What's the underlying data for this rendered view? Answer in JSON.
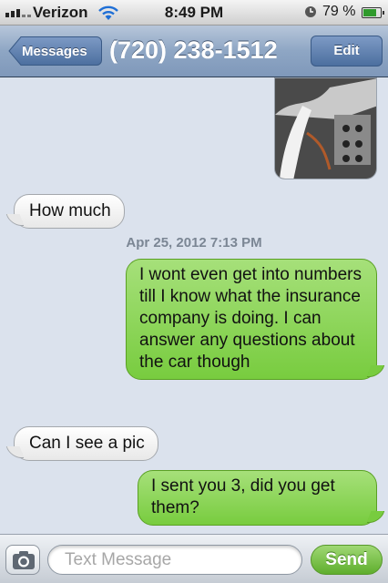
{
  "status_bar": {
    "carrier": "Verizon",
    "time": "8:49 PM",
    "battery_percent": "79 %",
    "battery_level": 0.79,
    "icons": [
      "signal-bars-icon",
      "wifi-icon",
      "alarm-clock-icon",
      "battery-icon"
    ]
  },
  "nav": {
    "back_label": "Messages",
    "title": "(720) 238-1512",
    "edit_label": "Edit"
  },
  "conversation": {
    "photo_label": "photo attachment",
    "messages": [
      {
        "direction": "received",
        "text": "How much"
      },
      {
        "direction": "sent",
        "text": "I wont even get into numbers till I know what the insurance company is doing. I can answer any questions about the car though"
      },
      {
        "direction": "received",
        "text": "Can I see a pic"
      },
      {
        "direction": "sent",
        "text": "I sent you 3, did you get them?"
      }
    ],
    "timestamp": "Apr 25, 2012 7:13 PM"
  },
  "composer": {
    "placeholder": "Text Message",
    "value": "",
    "send_label": "Send",
    "camera_icon": "camera-icon"
  },
  "colors": {
    "sent_bubble": "#78cc3f",
    "received_bubble": "#ffffff",
    "nav_bar": "#8ea6c4",
    "background": "#dbe2ed"
  }
}
